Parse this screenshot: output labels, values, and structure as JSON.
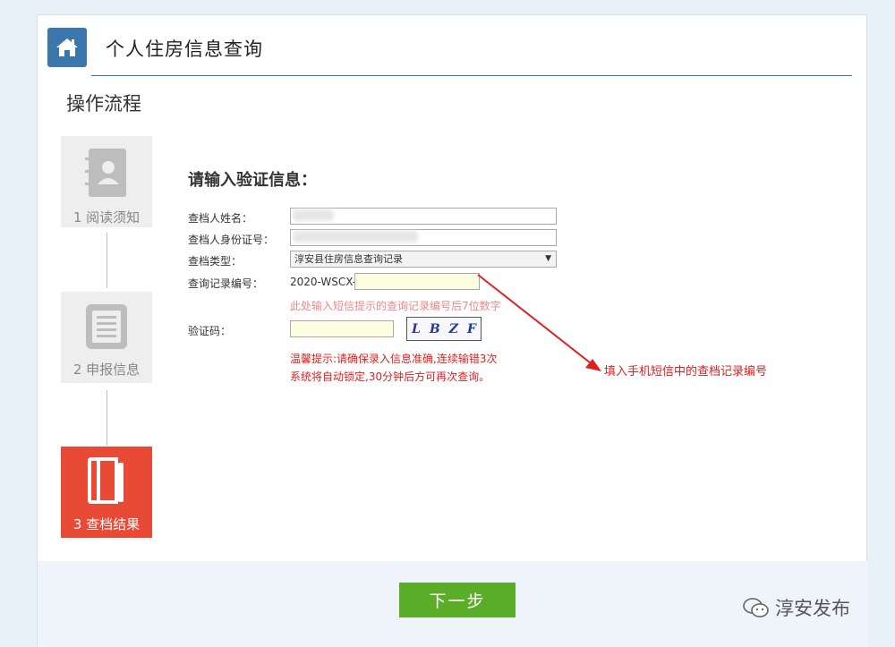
{
  "header": {
    "title": "个人住房信息查询"
  },
  "flow": {
    "title": "操作流程",
    "steps": [
      {
        "label": "1 阅读须知",
        "state": "inactive",
        "icon": "contact-book-icon"
      },
      {
        "label": "2 申报信息",
        "state": "inactive",
        "icon": "document-list-icon"
      },
      {
        "label": "3 查档结果",
        "state": "active",
        "icon": "folder-icon"
      }
    ]
  },
  "form": {
    "heading": "请输入验证信息：",
    "name_label": "查档人姓名：",
    "name_value": "",
    "id_label": "查档人身份证号：",
    "id_value": "",
    "type_label": "查档类型：",
    "type_value": "淳安县住房信息查询记录",
    "record_label": "查询记录编号：",
    "record_prefix": "2020-WSCX-",
    "record_value": "",
    "record_hint": "此处输入短信提示的查询记录编号后7位数字",
    "captcha_label": "验证码：",
    "captcha_value": "",
    "captcha_text": [
      "L",
      "B",
      "Z",
      "F"
    ],
    "warning": "温馨提示:请确保录入信息准确,连续输错3次系统将自动锁定,30分钟后方可再次查询。"
  },
  "annotation": "填入手机短信中的查档记录编号",
  "buttons": {
    "next": "下一步"
  },
  "watermark": "淳安发布",
  "colors": {
    "brand_blue": "#3b76ad",
    "active_step": "#e84a35",
    "next_button": "#5aad26",
    "warning_red": "#e02020"
  }
}
